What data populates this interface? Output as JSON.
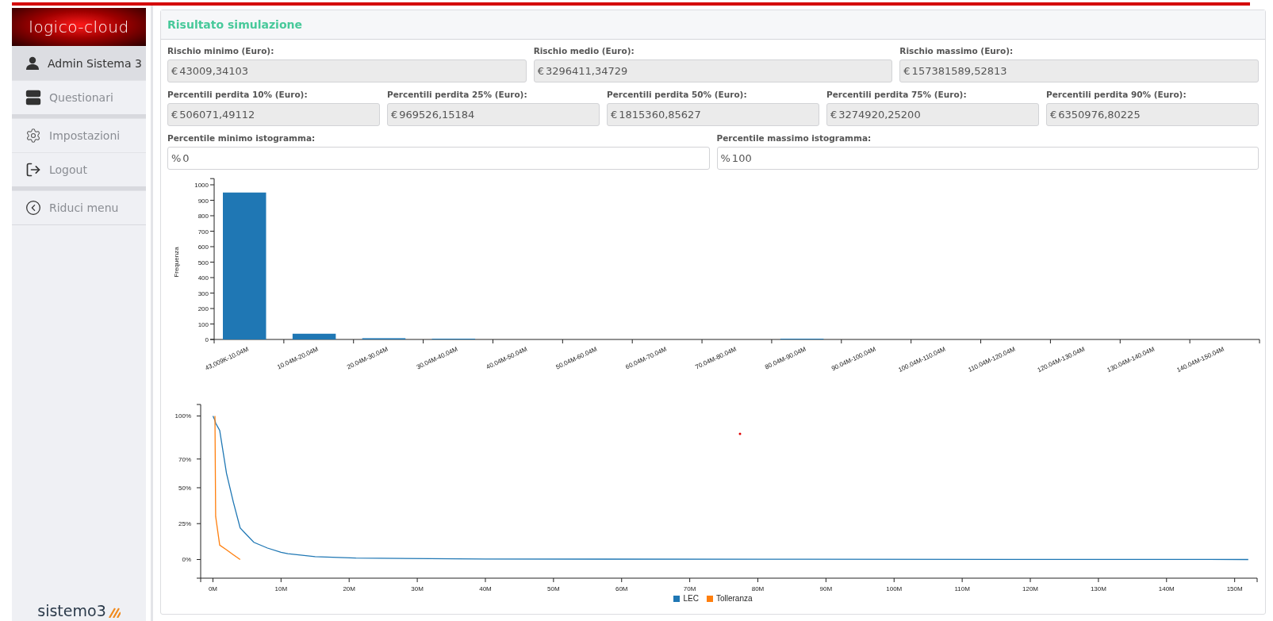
{
  "sidebar": {
    "logo": "logico-cloud",
    "groups": [
      {
        "items": [
          {
            "label": "Admin Sistema 3",
            "selected": true
          },
          {
            "label": "Questionari",
            "selected": false
          }
        ]
      },
      {
        "items": [
          {
            "label": "Impostazioni",
            "selected": false
          },
          {
            "label": "Logout",
            "selected": false
          }
        ]
      },
      {
        "items": [
          {
            "label": "Riduci menu",
            "selected": false
          }
        ]
      }
    ],
    "footer_logo": "sistemo3"
  },
  "panel": {
    "title": "Risultato simulazione",
    "rows": [
      [
        {
          "label": "Rischio minimo (Euro):",
          "prefix": "€",
          "value": "43009,34103",
          "readonly": true
        },
        {
          "label": "Rischio medio (Euro):",
          "prefix": "€",
          "value": "3296411,34729",
          "readonly": true
        },
        {
          "label": "Rischio massimo (Euro):",
          "prefix": "€",
          "value": "157381589,52813",
          "readonly": true
        }
      ],
      [
        {
          "label": "Percentili perdita 10% (Euro):",
          "prefix": "€",
          "value": "506071,49112",
          "readonly": true
        },
        {
          "label": "Percentili perdita 25% (Euro):",
          "prefix": "€",
          "value": "969526,15184",
          "readonly": true
        },
        {
          "label": "Percentili perdita 50% (Euro):",
          "prefix": "€",
          "value": "1815360,85627",
          "readonly": true
        },
        {
          "label": "Percentili perdita 75% (Euro):",
          "prefix": "€",
          "value": "3274920,25200",
          "readonly": true
        },
        {
          "label": "Percentili perdita 90% (Euro):",
          "prefix": "€",
          "value": "6350976,80225",
          "readonly": true
        }
      ],
      [
        {
          "label": "Percentile minimo istogramma:",
          "prefix": "%",
          "value": "0",
          "readonly": false
        },
        {
          "label": "Percentile massimo istogramma:",
          "prefix": "%",
          "value": "100",
          "readonly": false
        }
      ]
    ],
    "histogram": {
      "chart_data": {
        "type": "bar",
        "ylabel": "Frequenza",
        "categories": [
          "43,009K-10.04M",
          "10.04M-20.04M",
          "20.04M-30.04M",
          "30.04M-40.04M",
          "40.04M-50.04M",
          "50.04M-60.04M",
          "60.04M-70.04M",
          "70.04M-80.04M",
          "80.04M-90.04M",
          "90.04M-100.04M",
          "100.04M-110.04M",
          "110.04M-120.04M",
          "120.04M-130.04M",
          "130.04M-140.04M",
          "140.04M-150.04M"
        ],
        "series": [
          {
            "color": "#1f77b4",
            "values": [
              950,
              37,
              8,
              5,
              0,
              0,
              0,
              0,
              5,
              0,
              0,
              0,
              0,
              0,
              0
            ]
          }
        ],
        "ylim": [
          0,
          1040
        ],
        "yticks": [
          0,
          100,
          200,
          300,
          400,
          500,
          600,
          700,
          800,
          900,
          1000
        ]
      }
    },
    "lec": {
      "chart_data": {
        "type": "line",
        "x": [
          0,
          0.3,
          0.4,
          1,
          2,
          3,
          4,
          5,
          6,
          8,
          10,
          11,
          15,
          21,
          40,
          80,
          152
        ],
        "series": [
          {
            "name": "LEC",
            "color": "#1f77b4",
            "values": [
              100,
              97,
              95,
              90,
              60,
              40,
              22,
              17,
              12,
              8,
              5,
              4,
              2,
              1,
              0.3,
              0.2,
              0
            ]
          },
          {
            "name": "Tolleranza",
            "color": "#ff7f0e",
            "values": [
              null,
              100,
              30,
              10,
              6.7,
              3.3,
              0,
              null,
              null,
              null,
              null,
              null,
              null,
              null,
              null,
              null,
              null
            ]
          }
        ],
        "xlim": [
          -1.8,
          153.3
        ],
        "ylim": [
          -13,
          108
        ],
        "xticks": [
          {
            "value": 0,
            "label": "0M"
          },
          {
            "value": 10,
            "label": "10M"
          },
          {
            "value": 20,
            "label": "20M"
          },
          {
            "value": 30,
            "label": "30M"
          },
          {
            "value": 40,
            "label": "40M"
          },
          {
            "value": 50,
            "label": "50M"
          },
          {
            "value": 60,
            "label": "60M"
          },
          {
            "value": 70,
            "label": "70M"
          },
          {
            "value": 80,
            "label": "80M"
          },
          {
            "value": 90,
            "label": "90M"
          },
          {
            "value": 100,
            "label": "100M"
          },
          {
            "value": 110,
            "label": "110M"
          },
          {
            "value": 120,
            "label": "120M"
          },
          {
            "value": 130,
            "label": "130M"
          },
          {
            "value": 140,
            "label": "140M"
          },
          {
            "value": 150,
            "label": "150M"
          }
        ],
        "yticks": [
          {
            "value": 0,
            "label": "0%"
          },
          {
            "value": 25,
            "label": "25%"
          },
          {
            "value": 50,
            "label": "50%"
          },
          {
            "value": 70,
            "label": "70%"
          },
          {
            "value": 100,
            "label": "100%"
          }
        ]
      }
    }
  }
}
